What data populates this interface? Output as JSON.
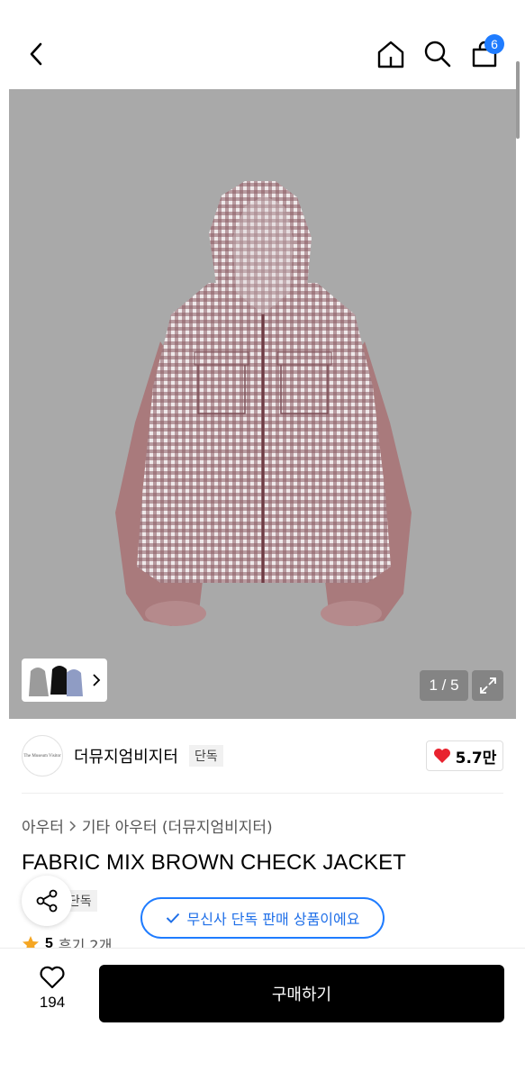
{
  "header": {
    "cart_count": "6"
  },
  "gallery": {
    "counter": "1 / 5"
  },
  "brand": {
    "logo_text": "The Museum Visitor",
    "name": "더뮤지엄비지터",
    "tag": "단독",
    "likes": "5.7만"
  },
  "product": {
    "breadcrumb": [
      "아우터",
      "기타 아우터 (더뮤지엄비지터)"
    ],
    "title": "FABRIC MIX BROWN CHECK JACKET",
    "exclusive_tag": "단독",
    "exclusive_notice": "무신사 단독 판매 상품이에요",
    "rating": "5",
    "reviews": "후기 2개"
  },
  "bottom": {
    "wish_count": "194",
    "buy_label": "구매하기"
  },
  "colors": {
    "accent_blue": "#1f7cff",
    "heart_red": "#e8232f",
    "star_orange": "#f5a623",
    "hero_bg": "#a9a9a9"
  }
}
